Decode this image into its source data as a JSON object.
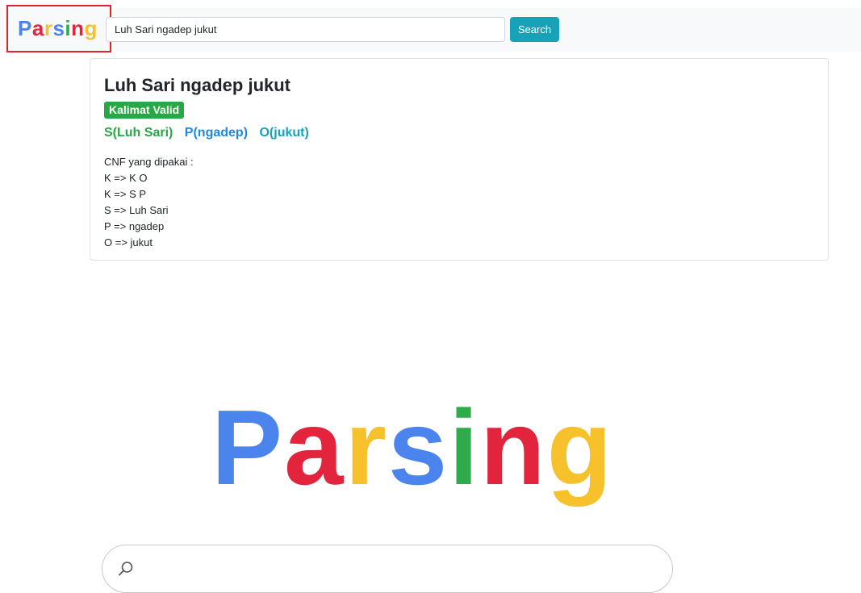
{
  "navbar": {
    "brand": [
      "P",
      "a",
      "r",
      "s",
      "i",
      "n",
      "g"
    ],
    "search_value": "Luh Sari ngadep jukut",
    "search_button": "Search"
  },
  "result": {
    "title": "Luh Sari ngadep jukut",
    "badge": "Kalimat Valid",
    "parse": {
      "s": "S(Luh Sari)",
      "p": "P(ngadep)",
      "o": "O(jukut)"
    },
    "cnf_header": "CNF yang dipakai :",
    "cnf_rules": [
      "K => K O",
      "K => S P",
      "S => Luh Sari",
      "P => ngadep",
      "O => jukut"
    ]
  },
  "logo": [
    "P",
    "a",
    "r",
    "s",
    "i",
    "n",
    "g"
  ],
  "colors": {
    "logo_letters": [
      "#4c84ee",
      "#e2243c",
      "#f6c12a",
      "#4c84ee",
      "#2eab4b",
      "#e2243c",
      "#f6c12a"
    ],
    "brand_letters": [
      "#4c84ee",
      "#e2243c",
      "#f6c12a",
      "#4c84ee",
      "#2eab4b",
      "#e2243c",
      "#f6c12a"
    ],
    "badge": "#28a745",
    "search_button": "#17a2b8"
  },
  "icons": {
    "bottom_search": "search-icon"
  }
}
